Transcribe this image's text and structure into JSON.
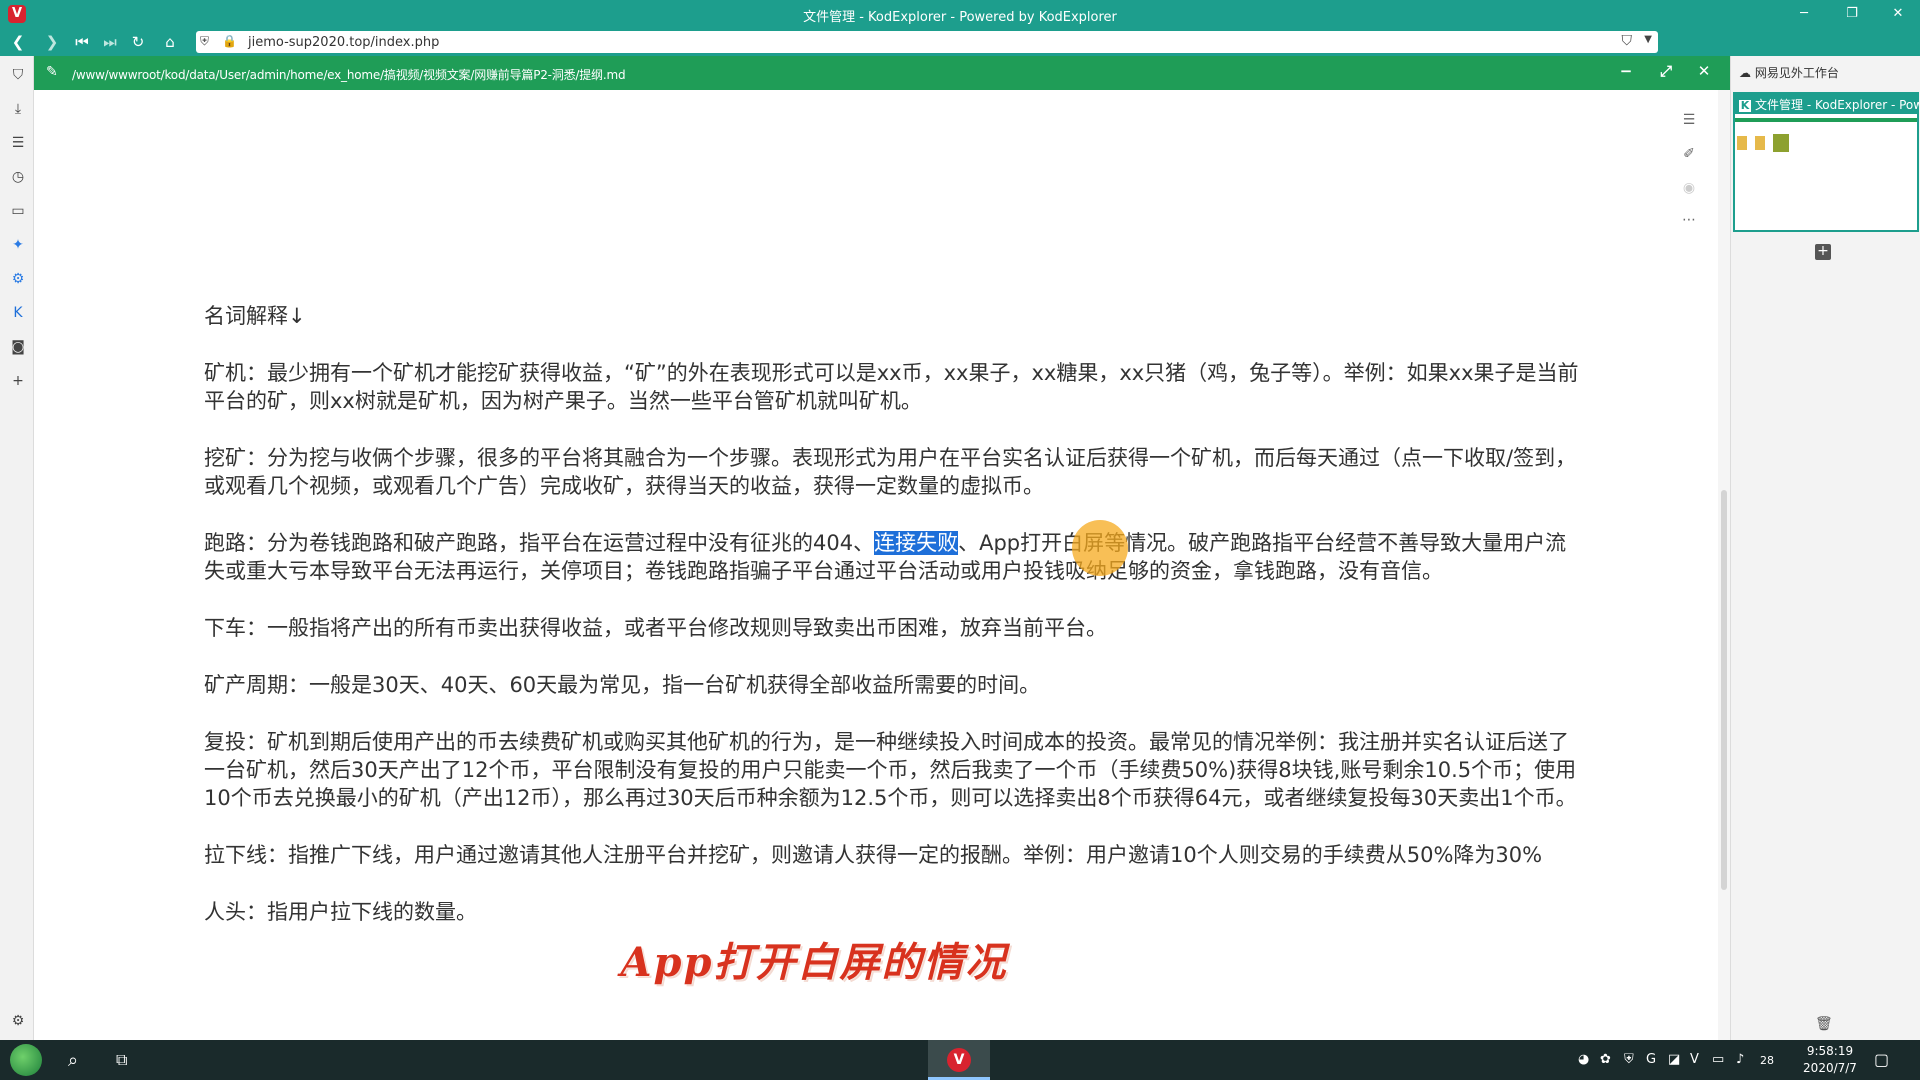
{
  "browser": {
    "title": "文件管理 - KodExplorer - Powered by KodExplorer",
    "url": "jiemo-sup2020.top/index.php"
  },
  "editor": {
    "path": "/www/wwwroot/kod/data/User/admin/home/ex_home/搞视频/视频文案/网赚前导篇P2-洞悉/提纲.md"
  },
  "document": {
    "heading": "名词解释↓",
    "p_miner": "矿机：最少拥有一个矿机才能挖矿获得收益，“矿”的外在表现形式可以是xx币，xx果子，xx糖果，xx只猪（鸡，兔子等）。举例：如果xx果子是当前平台的矿，则xx树就是矿机，因为树产果子。当然一些平台管矿机就叫矿机。",
    "p_mining": "挖矿：分为挖与收俩个步骤，很多的平台将其融合为一个步骤。表现形式为用户在平台实名认证后获得一个矿机，而后每天通过（点一下收取/签到，或观看几个视频，或观看几个广告）完成收矿，获得当天的收益，获得一定数量的虚拟币。",
    "p_run_before": "跑路：分为卷钱跑路和破产跑路，指平台在运营过程中没有征兆的404、",
    "p_run_selected": "连接失败",
    "p_run_after": "、App打开白屏等情况。破产跑路指平台经营不善导致大量用户流失或重大亏本导致平台无法再运行，关停项目；卷钱跑路指骗子平台通过平台活动或用户投钱吸纳足够的资金，拿钱跑路，没有音信。",
    "p_exit": "下车：一般指将产出的所有币卖出获得收益，或者平台修改规则导致卖出币困难，放弃当前平台。",
    "p_cycle": "矿产周期：一般是30天、40天、60天最为常见，指一台矿机获得全部收益所需要的时间。",
    "p_reinvest": "复投：矿机到期后使用产出的币去续费矿机或购买其他矿机的行为，是一种继续投入时间成本的投资。最常见的情况举例：我注册并实名认证后送了一台矿机，然后30天产出了12个币，平台限制没有复投的用户只能卖一个币，然后我卖了一个币（手续费50%)获得8块钱,账号剩余10.5个币；使用10个币去兑换最小的矿机（产出12币），那么再过30天后币种余额为12.5个币，则可以选择卖出8个币获得64元，或者继续复投每30天卖出1个币。",
    "p_downline": "拉下线：指推广下线，用户通过邀请其他人注册平台并挖矿，则邀请人获得一定的报酬。举例：用户邀请10个人则交易的手续费从50%降为30%",
    "p_head": "人头：指用户拉下线的数量。",
    "subtitle": "App打开白屏的情况"
  },
  "right_panel": {
    "workspace_label": "网易见外工作台",
    "tab_label": "文件管理 - KodExplorer - Pow"
  },
  "taskbar": {
    "time": "9:58:19",
    "date": "2020/7/7",
    "tray_number": "28"
  },
  "colors": {
    "browser_bar": "#1d9e8d",
    "editor_header": "#1f9d57",
    "selection": "#1e6fd9",
    "subtitle": "#d8321e"
  }
}
